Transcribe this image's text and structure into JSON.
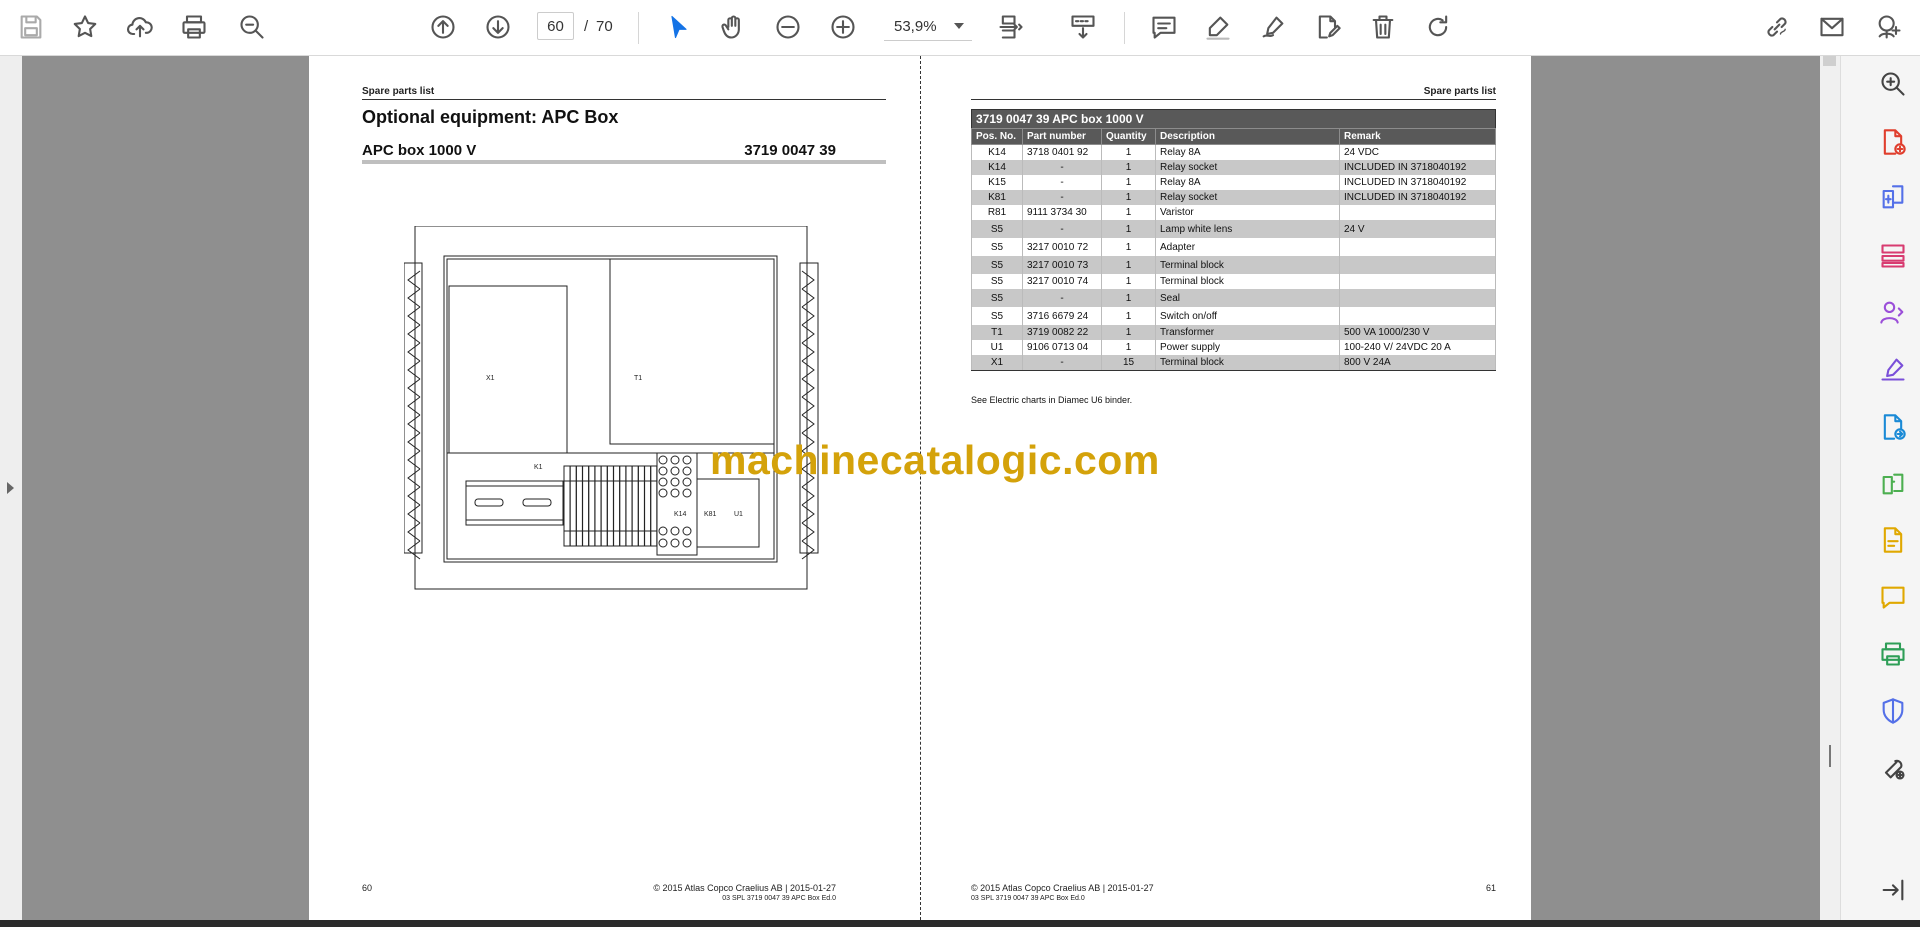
{
  "toolbar": {
    "current_page": "60",
    "page_separator": "/",
    "total_pages": "70",
    "zoom": "53,9%"
  },
  "colors": {
    "accent": "#1473e6",
    "watermark": "#d4a20a",
    "table_header": "#595959",
    "row_shade": "#c8c8c8"
  },
  "left_page": {
    "header": "Spare parts list",
    "title": "Optional equipment: APC Box",
    "subtitle": "APC box 1000 V",
    "part_no": "3719 0047 39",
    "page_number": "60",
    "copyright": "© 2015 Atlas Copco Craelius AB | 2015-01-27",
    "doc_id": "03 SPL 3719 0047 39 APC Box Ed.0",
    "drawing_labels": [
      "X1",
      "T1",
      "K1",
      "K14",
      "K81",
      "U1"
    ]
  },
  "right_page": {
    "header": "Spare parts list",
    "table_title": "3719 0047 39  APC box 1000 V",
    "columns": [
      "Pos. No.",
      "Part number",
      "Quantity",
      "Description",
      "Remark"
    ],
    "rows": [
      {
        "pos": "K14",
        "part": "3718 0401 92",
        "qty": "1",
        "desc": "Relay 8A",
        "remark": "24 VDC"
      },
      {
        "pos": "K14",
        "part": "-",
        "qty": "1",
        "desc": "Relay socket",
        "remark": "INCLUDED IN 3718040192"
      },
      {
        "pos": "K15",
        "part": "-",
        "qty": "1",
        "desc": "Relay 8A",
        "remark": "INCLUDED IN 3718040192"
      },
      {
        "pos": "K81",
        "part": "-",
        "qty": "1",
        "desc": "Relay socket",
        "remark": "INCLUDED IN 3718040192"
      },
      {
        "pos": "R81",
        "part": "9111 3734 30",
        "qty": "1",
        "desc": "Varistor",
        "remark": ""
      },
      {
        "pos": "S5",
        "part": "-",
        "qty": "1",
        "desc": "Lamp white lens",
        "remark": "24 V"
      },
      {
        "pos": "S5",
        "part": "3217 0010 72",
        "qty": "1",
        "desc": "Adapter",
        "remark": ""
      },
      {
        "pos": "S5",
        "part": "3217 0010 73",
        "qty": "1",
        "desc": "Terminal block",
        "remark": ""
      },
      {
        "pos": "S5",
        "part": "3217 0010 74",
        "qty": "1",
        "desc": "Terminal block",
        "remark": ""
      },
      {
        "pos": "S5",
        "part": "-",
        "qty": "1",
        "desc": "Seal",
        "remark": ""
      },
      {
        "pos": "S5",
        "part": "3716 6679 24",
        "qty": "1",
        "desc": "Switch on/off",
        "remark": ""
      },
      {
        "pos": "T1",
        "part": "3719 0082 22",
        "qty": "1",
        "desc": "Transformer",
        "remark": "500 VA 1000/230 V"
      },
      {
        "pos": "U1",
        "part": "9106 0713 04",
        "qty": "1",
        "desc": "Power supply",
        "remark": "100-240 V/ 24VDC 20 A"
      },
      {
        "pos": "X1",
        "part": "-",
        "qty": "15",
        "desc": "Terminal block",
        "remark": "800 V 24A"
      }
    ],
    "note": "See Electric charts in Diamec U6 binder.",
    "page_number": "61",
    "copyright": "© 2015 Atlas Copco Craelius AB | 2015-01-27",
    "doc_id": "03 SPL 3719 0047 39 APC Box Ed.0"
  },
  "watermark": "machinecatalogic.com"
}
